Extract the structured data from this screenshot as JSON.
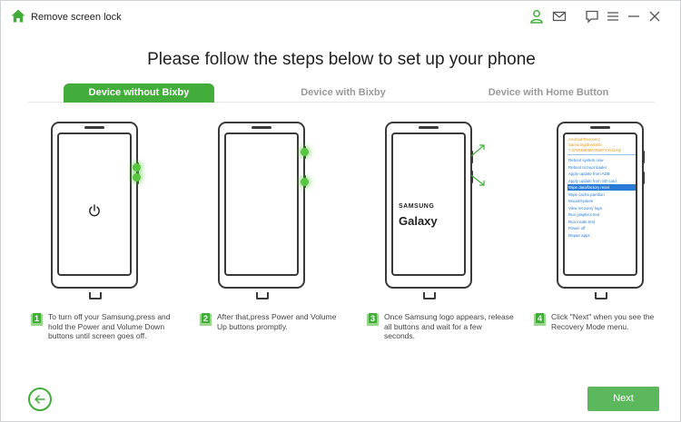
{
  "window": {
    "title": "Remove screen lock"
  },
  "heading": "Please follow the steps below to set up your phone",
  "tabs": [
    {
      "label": "Device without Bixby",
      "active": true
    },
    {
      "label": "Device with Bixby",
      "active": false
    },
    {
      "label": "Device with Home Button",
      "active": false
    }
  ],
  "phone3": {
    "brand": "SAMSUNG",
    "model": "Galaxy"
  },
  "recovery_menu": {
    "header_lines": [
      "Android Recovery",
      "Samsung/dreamlte",
      "7.0/NRD90M/G950FXXU1AQ"
    ],
    "items": [
      "Reboot system now",
      "Reboot to boot loader",
      "Apply update from ADB",
      "Apply update from SD card",
      "Wipe data/factory reset",
      "Wipe cache partition",
      "Mount/system",
      "View recovery logs",
      "Run graphics test",
      "Run locale test",
      "Power off",
      "Repair apps"
    ],
    "selected": "Wipe data/factory reset"
  },
  "steps": [
    {
      "num": "1",
      "lines": [
        "To turn off your Samsung,press and",
        "hold the Power and Volume Down",
        "buttons until screen goes off."
      ]
    },
    {
      "num": "2",
      "lines": [
        "After that,press Power and Volume",
        "Up buttons promptly."
      ]
    },
    {
      "num": "3",
      "lines": [
        "Once Samsung logo appears, release",
        "all buttons and wait for a few",
        "seconds."
      ]
    },
    {
      "num": "4",
      "lines": [
        "Click \"Next\" when you see the",
        "Recovery Mode menu."
      ]
    }
  ],
  "footer": {
    "next_label": "Next"
  },
  "colors": {
    "accent": "#43ad3b",
    "next_button": "#5cb85c",
    "recovery_blue": "#2a7bd6",
    "recovery_orange": "#e8961a"
  }
}
